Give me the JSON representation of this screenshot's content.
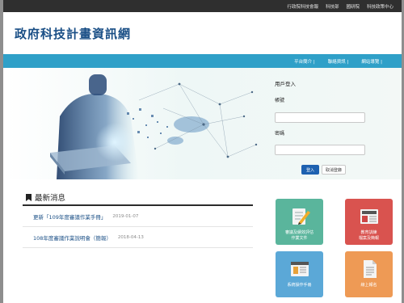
{
  "topbar": {
    "links": [
      "行政院科技會報",
      "科技部",
      "國研院",
      "科技政策中心"
    ]
  },
  "header": {
    "title": "政府科技計畫資訊網"
  },
  "nav": {
    "items": [
      "平台簡介 |",
      "聯絡資訊 |",
      "網站導覽 |"
    ]
  },
  "login": {
    "title": "用戶登入",
    "account_label": "帳號",
    "password_label": "密碼",
    "account_value": "",
    "password_value": "",
    "login_button": "登入",
    "cancel_button": "取消登錄"
  },
  "news": {
    "title": "最新消息",
    "items": [
      {
        "text": "更新「109年度審議作業手冊」",
        "date": "2019-01-07"
      },
      {
        "text": "108年度審議作業說明會（簡報）",
        "date": "2018-04-13"
      }
    ]
  },
  "tiles": [
    {
      "label_lines": [
        "審議及績效評估",
        "作業文件"
      ],
      "color": "#5ab59c",
      "icon": "pencil-document-icon"
    },
    {
      "label_lines": [
        "教育訓練",
        "檔案及簡報"
      ],
      "color": "#d9534f",
      "icon": "newspaper-icon"
    },
    {
      "label_lines": [
        "系統操作手冊"
      ],
      "color": "#5ba8d7",
      "icon": "browser-window-icon"
    },
    {
      "label_lines": [
        "線上報名"
      ],
      "color": "#ee9a55",
      "icon": "document-icon"
    }
  ],
  "colors": {
    "topbar": "#2f2f2f",
    "title": "#1a4f86",
    "nav": "#2fa0c8",
    "login_button": "#1e61b0"
  }
}
